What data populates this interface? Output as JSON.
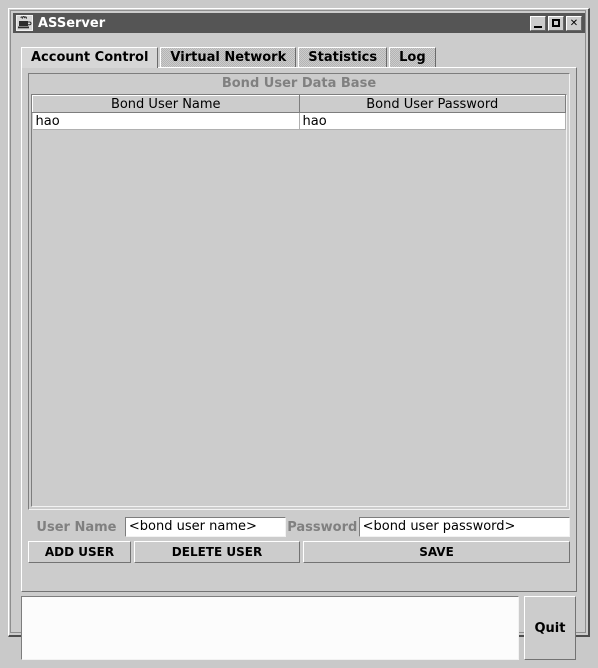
{
  "window": {
    "title": "ASServer",
    "icon": "java-coffee-cup-icon",
    "controls": {
      "minimize_label": "_",
      "maximize_label": "□",
      "close_label": "✕"
    },
    "colors": {
      "titlebar": "#555555",
      "face": "#cccccc",
      "shadow": "#7d7d7d",
      "highlight": "#ffffff",
      "disabled_text": "#808080"
    }
  },
  "tabs": [
    {
      "label": "Account Control",
      "active": true
    },
    {
      "label": "Virtual Network",
      "active": false
    },
    {
      "label": "Statistics",
      "active": false
    },
    {
      "label": "Log",
      "active": false
    }
  ],
  "account_control": {
    "database_title": "Bond User Data Base",
    "table": {
      "columns": [
        "Bond User Name",
        "Bond User Password"
      ],
      "rows": [
        [
          "hao",
          "hao"
        ]
      ]
    },
    "form": {
      "username_label": "User Name",
      "username_value": "<bond user name>",
      "password_label": "Password",
      "password_value": "<bond user password>"
    },
    "buttons": {
      "add_user": "ADD USER",
      "delete_user": "DELETE USER",
      "save": "SAVE"
    }
  },
  "status": {
    "log_text": "",
    "quit_label": "Quit"
  }
}
